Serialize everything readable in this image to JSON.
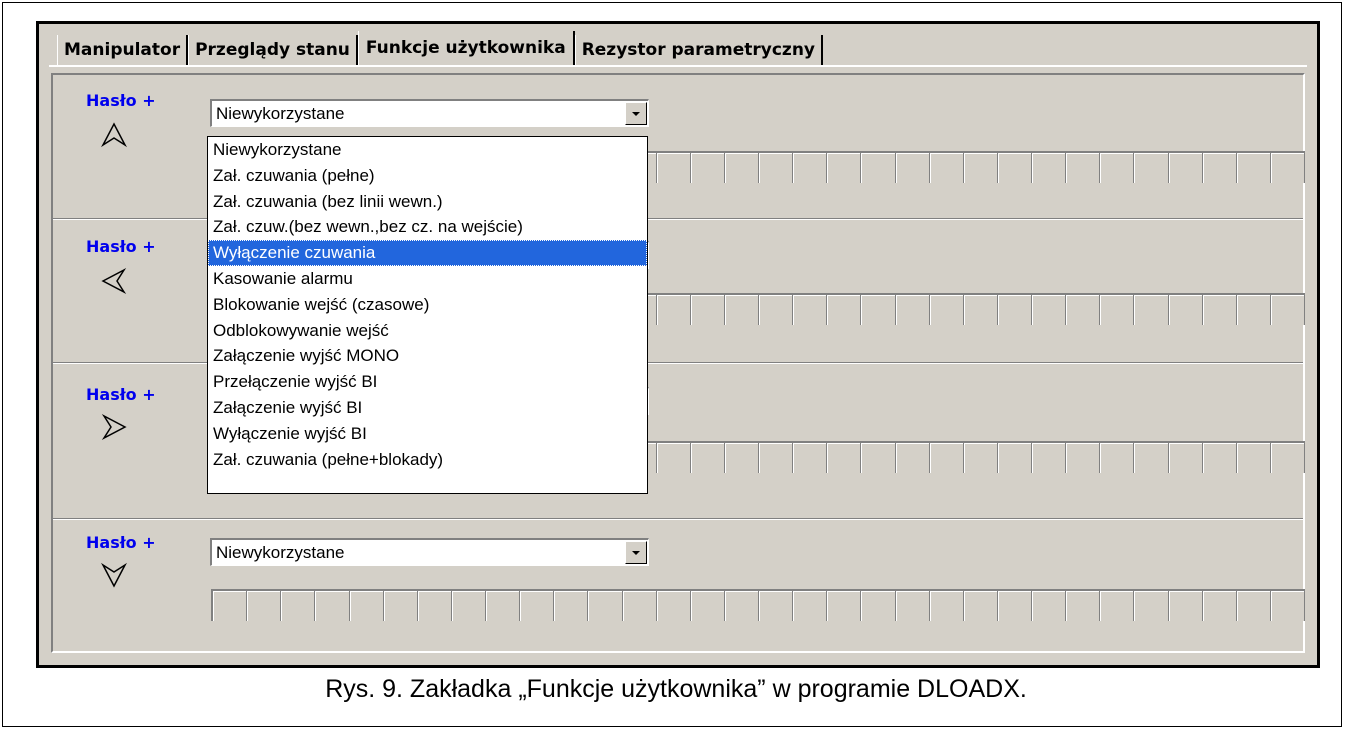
{
  "tabs": [
    "Manipulator",
    "Przeglądy stanu",
    "Funkcje użytkownika",
    "Rezystor parametryczny"
  ],
  "active_tab_index": 2,
  "sections": [
    {
      "label": "Hasło +",
      "arrow": "up-arrow-icon",
      "value": "Niewykorzystane"
    },
    {
      "label": "Hasło +",
      "arrow": "left-arrow-icon",
      "value": ""
    },
    {
      "label": "Hasło +",
      "arrow": "right-arrow-icon",
      "value": ""
    },
    {
      "label": "Hasło +",
      "arrow": "down-arrow-icon",
      "value": "Niewykorzystane"
    }
  ],
  "dropdown": {
    "options": [
      "Niewykorzystane",
      "Zał. czuwania (pełne)",
      "Zał. czuwania (bez linii wewn.)",
      "Zał. czuw.(bez wewn.,bez cz. na wejście)",
      "Wyłączenie czuwania",
      "Kasowanie alarmu",
      "Blokowanie wejść (czasowe)",
      "Odblokowywanie wejść",
      "Załączenie wyjść MONO",
      "Przełączenie wyjść BI",
      "Załączenie wyjść BI",
      "Wyłączenie wyjść BI",
      "Zał. czuwania (pełne+blokady)"
    ],
    "highlighted_index": 4
  },
  "colors": {
    "label_blue": "#0000ee",
    "highlight": "#2266dd",
    "panel": "#d4d0c8"
  },
  "caption": "Rys. 9. Zakładka „Funkcje użytkownika” w programie DLOADX."
}
